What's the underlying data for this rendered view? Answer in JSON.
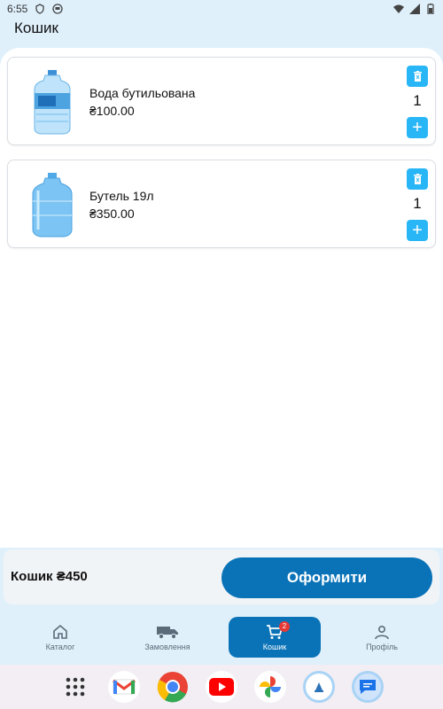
{
  "status_bar": {
    "time": "6:55"
  },
  "app_bar": {
    "title": "Кошик"
  },
  "cart": {
    "items": [
      {
        "name": "Вода бутильована",
        "price": "₴100.00",
        "quantity": "1",
        "image": "water-bottle-icon"
      },
      {
        "name": "Бутель 19л",
        "price": "₴350.00",
        "quantity": "1",
        "image": "water-jug-icon"
      }
    ],
    "add_label": "+"
  },
  "checkout": {
    "total_label": "Кошик ₴450",
    "button_label": "Оформити"
  },
  "nav": {
    "items": [
      {
        "label": "Каталог",
        "icon": "home-icon"
      },
      {
        "label": "Замовлення",
        "icon": "delivery-truck-icon"
      },
      {
        "label": "Кошик",
        "icon": "cart-icon",
        "badge": "2",
        "active": true
      },
      {
        "label": "Профіль",
        "icon": "person-icon"
      }
    ]
  },
  "dock": {
    "apps": [
      "app-drawer-icon",
      "gmail-icon",
      "chrome-icon",
      "youtube-icon",
      "photos-icon",
      "app-icon",
      "messages-icon"
    ]
  },
  "colors": {
    "accent": "#0a73b7",
    "button_light": "#29b6f6",
    "badge": "#e53935",
    "background": "#dff0fb"
  }
}
